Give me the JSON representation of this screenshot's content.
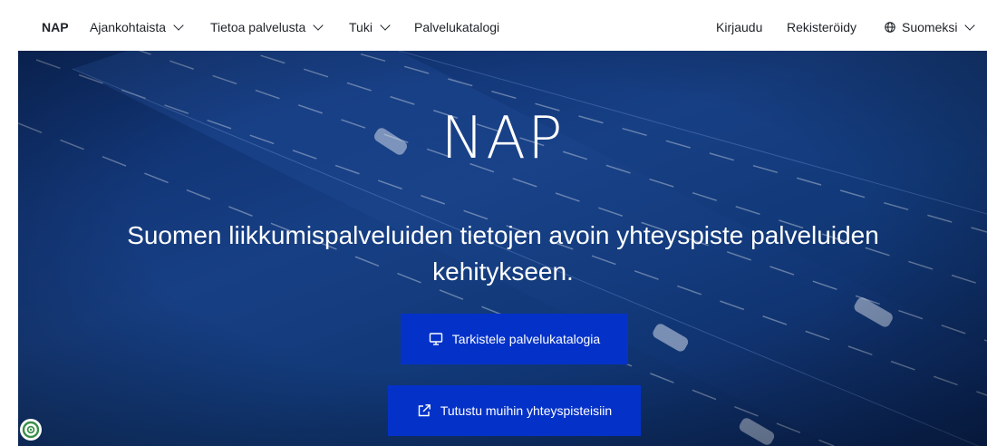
{
  "nav": {
    "brand": "NAP",
    "items": [
      {
        "label": "Ajankohtaista",
        "dropdown": true
      },
      {
        "label": "Tietoa palvelusta",
        "dropdown": true
      },
      {
        "label": "Tuki",
        "dropdown": true
      },
      {
        "label": "Palvelukatalogi",
        "dropdown": false
      }
    ],
    "login": "Kirjaudu",
    "register": "Rekisteröidy",
    "language": "Suomeksi"
  },
  "hero": {
    "title": "NAP",
    "subtitle": "Suomen liikkumispalveluiden tietojen avoin yhteyspiste palveluiden kehitykseen.",
    "buttons": [
      {
        "label": "Tarkistele palvelukatalogia",
        "icon": "monitor-icon"
      },
      {
        "label": "Tutustu muihin yhteyspisteisiin",
        "icon": "external-link-icon"
      }
    ]
  },
  "colors": {
    "button_bg": "#0432c9",
    "hero_bg": "#173f84",
    "text": "#1f2328"
  }
}
